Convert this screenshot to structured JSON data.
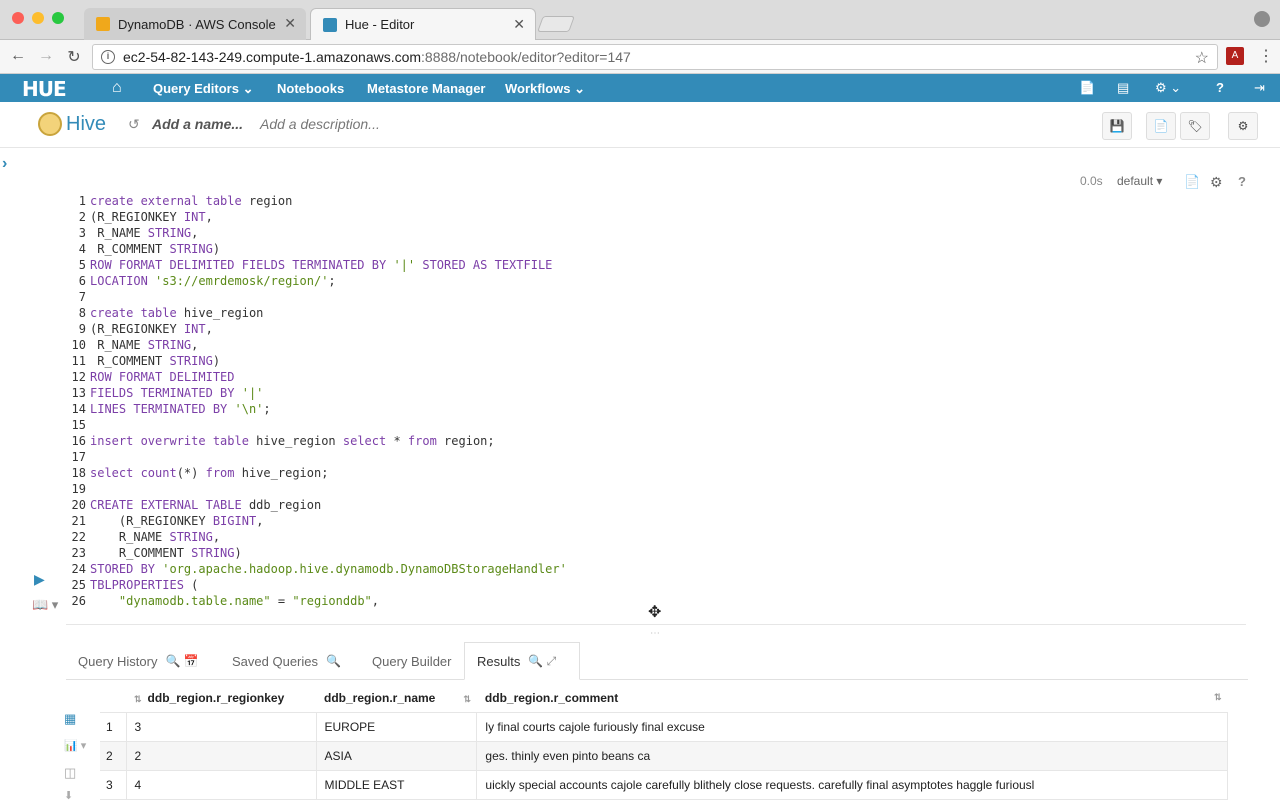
{
  "browser": {
    "tabs": [
      {
        "title": "DynamoDB · AWS Console",
        "favicon_color": "#f0a81b"
      },
      {
        "title": "Hue - Editor",
        "favicon_color": "#338bb8"
      }
    ],
    "close_glyph": "✕",
    "url_host": "ec2-54-82-143-249.compute-1.amazonaws.com",
    "url_rest": ":8888/notebook/editor?editor=147",
    "back_glyph": "←",
    "forward_glyph": "→",
    "reload_glyph": "↻",
    "star_glyph": "☆",
    "menu_glyph": "⋮"
  },
  "hue_nav": {
    "logo": "HUE",
    "home_glyph": "⌂",
    "items": [
      "Query Editors ⌄",
      "Notebooks",
      "Metastore Manager",
      "Workflows ⌄"
    ],
    "right_icons": [
      "📄",
      "▤",
      "⚙ ⌄",
      "?",
      "⇥"
    ]
  },
  "editor_header": {
    "engine": "Hive",
    "history_glyph": "↺",
    "name_placeholder": "Add a name...",
    "description_placeholder": "Add a description...",
    "buttons": [
      "💾",
      "📄",
      "🏷",
      "⚙"
    ]
  },
  "sidebar_toggle_glyph": "›",
  "snippet": {
    "duration": "0.0s",
    "database": "default ▾",
    "tool_icons": [
      "📄",
      "⚙",
      "?"
    ]
  },
  "code_lines": [
    [
      {
        "k": "kw",
        "t": "create external table"
      },
      {
        "t": " region"
      }
    ],
    [
      {
        "t": "(R_REGIONKEY "
      },
      {
        "k": "kw",
        "t": "INT"
      },
      {
        "t": ","
      }
    ],
    [
      {
        "t": " R_NAME "
      },
      {
        "k": "kw",
        "t": "STRING"
      },
      {
        "t": ","
      }
    ],
    [
      {
        "t": " R_COMMENT "
      },
      {
        "k": "kw",
        "t": "STRING"
      },
      {
        "t": ")"
      }
    ],
    [
      {
        "k": "kw",
        "t": "ROW FORMAT DELIMITED FIELDS TERMINATED BY "
      },
      {
        "k": "str",
        "t": "'|'"
      },
      {
        "k": "kw",
        "t": " STORED AS TEXTFILE"
      }
    ],
    [
      {
        "k": "kw",
        "t": "LOCATION "
      },
      {
        "k": "str",
        "t": "'s3://emrdemosk/region/'"
      },
      {
        "t": ";"
      }
    ],
    [],
    [
      {
        "k": "kw",
        "t": "create table"
      },
      {
        "t": " hive_region"
      }
    ],
    [
      {
        "t": "(R_REGIONKEY "
      },
      {
        "k": "kw",
        "t": "INT"
      },
      {
        "t": ","
      }
    ],
    [
      {
        "t": " R_NAME "
      },
      {
        "k": "kw",
        "t": "STRING"
      },
      {
        "t": ","
      }
    ],
    [
      {
        "t": " R_COMMENT "
      },
      {
        "k": "kw",
        "t": "STRING"
      },
      {
        "t": ")"
      }
    ],
    [
      {
        "k": "kw",
        "t": "ROW FORMAT DELIMITED"
      }
    ],
    [
      {
        "k": "kw",
        "t": "FIELDS TERMINATED BY "
      },
      {
        "k": "str",
        "t": "'|'"
      }
    ],
    [
      {
        "k": "kw",
        "t": "LINES TERMINATED BY "
      },
      {
        "k": "str",
        "t": "'\\n'"
      },
      {
        "t": ";"
      }
    ],
    [],
    [
      {
        "k": "kw",
        "t": "insert overwrite table"
      },
      {
        "t": " hive_region "
      },
      {
        "k": "kw",
        "t": "select"
      },
      {
        "t": " * "
      },
      {
        "k": "kw",
        "t": "from"
      },
      {
        "t": " region;"
      }
    ],
    [],
    [
      {
        "k": "kw",
        "t": "select count"
      },
      {
        "t": "(*) "
      },
      {
        "k": "kw",
        "t": "from"
      },
      {
        "t": " hive_region;"
      }
    ],
    [],
    [
      {
        "k": "kw",
        "t": "CREATE EXTERNAL TABLE"
      },
      {
        "t": " ddb_region"
      }
    ],
    [
      {
        "t": "    (R_REGIONKEY "
      },
      {
        "k": "kw",
        "t": "BIGINT"
      },
      {
        "t": ","
      }
    ],
    [
      {
        "t": "    R_NAME "
      },
      {
        "k": "kw",
        "t": "STRING"
      },
      {
        "t": ","
      }
    ],
    [
      {
        "t": "    R_COMMENT "
      },
      {
        "k": "kw",
        "t": "STRING"
      },
      {
        "t": ")"
      }
    ],
    [
      {
        "k": "kw",
        "t": "STORED BY "
      },
      {
        "k": "str",
        "t": "'org.apache.hadoop.hive.dynamodb.DynamoDBStorageHandler'"
      }
    ],
    [
      {
        "k": "kw",
        "t": "TBLPROPERTIES"
      },
      {
        "t": " ("
      }
    ],
    [
      {
        "t": "    "
      },
      {
        "k": "str",
        "t": "\"dynamodb.table.name\""
      },
      {
        "t": " = "
      },
      {
        "k": "str",
        "t": "\"regionddb\""
      },
      {
        "t": ","
      }
    ]
  ],
  "run_glyph": "▶",
  "book_glyph": "📖 ▾",
  "move_cursor_glyph": "✥",
  "drag_handle_glyph": "⋯",
  "result_tabs": [
    {
      "label": "Query History",
      "icons": "🔍 📅"
    },
    {
      "label": "Saved Queries",
      "icons": "🔍"
    },
    {
      "label": "Query Builder",
      "icons": ""
    },
    {
      "label": "Results",
      "icons": "🔍 ⤢"
    }
  ],
  "result_side_icons": [
    "▦",
    "📊 ▾",
    "◫",
    "⬇"
  ],
  "results": {
    "columns": [
      "ddb_region.r_regionkey",
      "ddb_region.r_name",
      "ddb_region.r_comment"
    ],
    "sort_glyph": "⇅",
    "rows": [
      [
        "1",
        "3",
        "EUROPE",
        "ly final courts cajole furiously final excuse"
      ],
      [
        "2",
        "2",
        "ASIA",
        "ges. thinly even pinto beans ca"
      ],
      [
        "3",
        "4",
        "MIDDLE EAST",
        "uickly special accounts cajole carefully blithely close requests. carefully final asymptotes haggle furiousl"
      ]
    ]
  }
}
